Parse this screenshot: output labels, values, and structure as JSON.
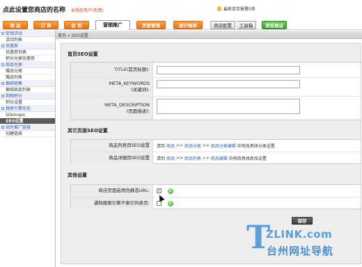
{
  "header": {
    "shop_title": "点此设置您商店的名称",
    "account_note": "本授权用户(免费)",
    "notice": "最新库存报警0条"
  },
  "nav": {
    "tabs": [
      "商 品",
      "订 单",
      "会 员",
      "营销推广",
      "页面管理",
      "统计报表",
      "商店配置",
      "工具箱",
      "浏览商店"
    ],
    "active_tab": "营销推广"
  },
  "breadcrumb": "首页 » SEO设置",
  "sidebar": {
    "groups": [
      {
        "title": "促销活动",
        "items": [
          "活动列表"
        ]
      },
      {
        "title": "优惠券",
        "items": [
          "优惠券列表",
          "积分兑换优惠券"
        ]
      },
      {
        "title": "商品兑换",
        "items": [
          "赠品分类",
          "赠品列表"
        ]
      },
      {
        "title": "捆绑销售",
        "items": [
          "捆绑商品列表"
        ]
      },
      {
        "title": "购物积分",
        "items": [
          "积分设置"
        ]
      },
      {
        "title": "搜索引擎优化",
        "items": [
          "Sitemaps",
          "SEO设置"
        ]
      },
      {
        "title": "站外推广链接",
        "items": [
          "创建链接"
        ]
      }
    ],
    "active_item": "SEO设置"
  },
  "home_seo": {
    "section_title": "首页SEO设置",
    "title_label": "TITLE(首页标题):",
    "title_value": "",
    "keywords_label_1": "META_KEYWORDS",
    "keywords_label_2": "(关键词):",
    "keywords_value": "",
    "description_label_1": "META_DESCRIPTION",
    "description_label_2": "(页面描述):",
    "description_value": ""
  },
  "other_seo": {
    "section_title": "其它页面SEO设置",
    "rows": [
      {
        "label": "商品列表页SEO设置",
        "prefix": "请到",
        "links": [
          "商品",
          "商品分类",
          "商品分类编辑"
        ],
        "suffix": "中修改具体分类设置"
      },
      {
        "label": "商品详细页SEO设置",
        "prefix": "请到",
        "links": [
          "商品",
          "商品列表",
          "商品编辑"
        ],
        "suffix": "中修改具体商品设置"
      }
    ],
    "separator": ">>"
  },
  "other_settings": {
    "section_title": "其他设置",
    "static_url_label": "商店页面启用伪静态URL:",
    "static_url_checked": true,
    "noindex_label": "通知搜索引擎不索引列表页:",
    "noindex_checked": false,
    "info_icon_text": "i"
  },
  "save_label": "保存",
  "watermark": {
    "big_letter": "T",
    "url": "ZLINK.com",
    "cn": "台州网址导航"
  },
  "colors": {
    "nav_orange": "#ea7311",
    "link_blue": "#2b5cb8",
    "watermark_blue": "#5a9fd8"
  }
}
